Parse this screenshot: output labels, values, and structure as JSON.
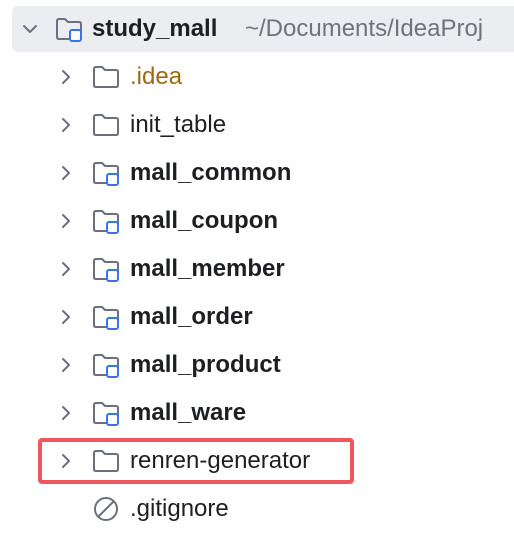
{
  "tree": {
    "root": {
      "name": "study_mall",
      "path": "~/Documents/IdeaProj",
      "expanded": true,
      "icon": "module-folder-icon"
    },
    "children": [
      {
        "name": ".idea",
        "icon": "folder-icon",
        "style": "idea"
      },
      {
        "name": "init_table",
        "icon": "folder-icon",
        "style": "normal"
      },
      {
        "name": "mall_common",
        "icon": "module-folder-icon",
        "style": "bold"
      },
      {
        "name": "mall_coupon",
        "icon": "module-folder-icon",
        "style": "bold"
      },
      {
        "name": "mall_member",
        "icon": "module-folder-icon",
        "style": "bold"
      },
      {
        "name": "mall_order",
        "icon": "module-folder-icon",
        "style": "bold"
      },
      {
        "name": "mall_product",
        "icon": "module-folder-icon",
        "style": "bold"
      },
      {
        "name": "mall_ware",
        "icon": "module-folder-icon",
        "style": "bold"
      },
      {
        "name": "renren-generator",
        "icon": "folder-icon",
        "style": "normal",
        "highlighted": true
      },
      {
        "name": ".gitignore",
        "icon": "ignored-file-icon",
        "style": "normal"
      }
    ]
  },
  "colors": {
    "root_bg": "#ebedf0",
    "highlight_border": "#f0565d",
    "module_marker": "#3574f0",
    "idea_text": "#9a6a12"
  }
}
